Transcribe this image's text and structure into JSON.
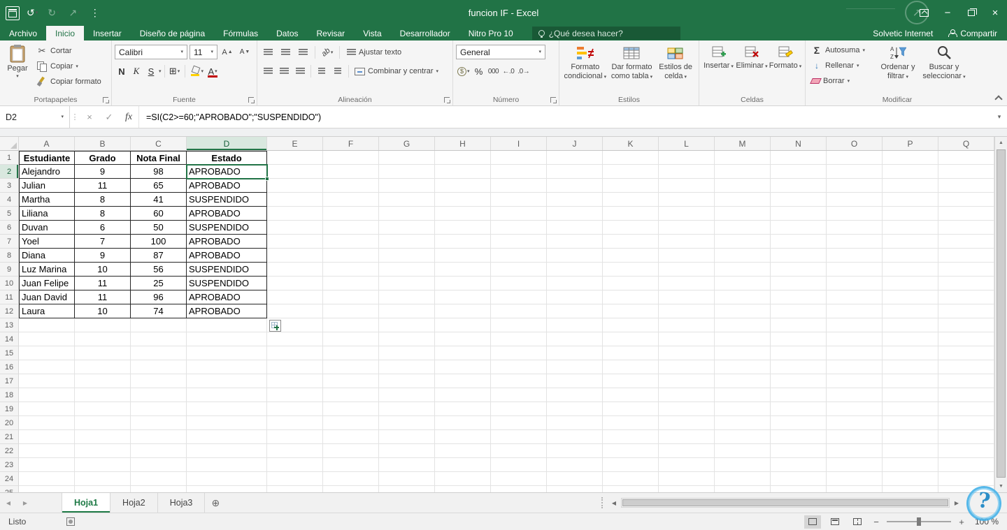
{
  "title_bar": {
    "title": "funcion IF - Excel",
    "account_name": "Solvetic Internet",
    "share_label": "Compartir"
  },
  "search": {
    "placeholder": "¿Qué desea hacer?"
  },
  "ribbon_tabs": [
    {
      "label": "Archivo",
      "active": false
    },
    {
      "label": "Inicio",
      "active": true
    },
    {
      "label": "Insertar",
      "active": false
    },
    {
      "label": "Diseño de página",
      "active": false
    },
    {
      "label": "Fórmulas",
      "active": false
    },
    {
      "label": "Datos",
      "active": false
    },
    {
      "label": "Revisar",
      "active": false
    },
    {
      "label": "Vista",
      "active": false
    },
    {
      "label": "Desarrollador",
      "active": false
    },
    {
      "label": "Nitro Pro 10",
      "active": false
    }
  ],
  "ribbon": {
    "clipboard": {
      "paste": "Pegar",
      "cut": "Cortar",
      "copy": "Copiar",
      "format_painter": "Copiar formato",
      "group_label": "Portapapeles"
    },
    "font": {
      "family": "Calibri",
      "size": "11",
      "bold": "N",
      "italic": "K",
      "underline": "S",
      "group_label": "Fuente"
    },
    "alignment": {
      "wrap_text": "Ajustar texto",
      "merge_center": "Combinar y centrar",
      "group_label": "Alineación"
    },
    "number": {
      "format": "General",
      "percent": "%",
      "thousands": "000",
      "group_label": "Número"
    },
    "styles": {
      "conditional": "Formato condicional",
      "format_table": "Dar formato como tabla",
      "cell_styles": "Estilos de celda",
      "group_label": "Estilos"
    },
    "cells": {
      "insert": "Insertar",
      "delete": "Eliminar",
      "format": "Formato",
      "group_label": "Celdas"
    },
    "editing": {
      "autosum": "Autosuma",
      "fill": "Rellenar",
      "clear": "Borrar",
      "sort": "Ordenar y filtrar",
      "find": "Buscar y seleccionar",
      "group_label": "Modificar"
    }
  },
  "formula_bar": {
    "name_box": "D2",
    "formula": "=SI(C2>=60;\"APROBADO\";\"SUSPENDIDO\")"
  },
  "grid": {
    "columns": [
      "A",
      "B",
      "C",
      "D",
      "E",
      "F",
      "G",
      "H",
      "I",
      "J",
      "K",
      "L",
      "M",
      "N",
      "O",
      "P",
      "Q"
    ],
    "row_count": 25,
    "selected": {
      "column": "D",
      "row": 2
    },
    "table": {
      "headers": [
        "Estudiante",
        "Grado",
        "Nota Final",
        "Estado"
      ],
      "rows": [
        [
          "Alejandro",
          "9",
          "98",
          "APROBADO"
        ],
        [
          "Julian",
          "11",
          "65",
          "APROBADO"
        ],
        [
          "Martha",
          "8",
          "41",
          "SUSPENDIDO"
        ],
        [
          "Liliana",
          "8",
          "60",
          "APROBADO"
        ],
        [
          "Duvan",
          "6",
          "50",
          "SUSPENDIDO"
        ],
        [
          "Yoel",
          "7",
          "100",
          "APROBADO"
        ],
        [
          "Diana",
          "9",
          "87",
          "APROBADO"
        ],
        [
          "Luz Marina",
          "10",
          "56",
          "SUSPENDIDO"
        ],
        [
          "Juan Felipe",
          "11",
          "25",
          "SUSPENDIDO"
        ],
        [
          "Juan David",
          "11",
          "96",
          "APROBADO"
        ],
        [
          "Laura",
          "10",
          "74",
          "APROBADO"
        ]
      ]
    }
  },
  "sheet_tabs": {
    "tabs": [
      {
        "label": "Hoja1",
        "active": true
      },
      {
        "label": "Hoja2",
        "active": false
      },
      {
        "label": "Hoja3",
        "active": false
      }
    ]
  },
  "status_bar": {
    "ready_label": "Listo",
    "zoom_level": "100 %"
  },
  "icons": {
    "chevron_down": "▾",
    "undo": "↺",
    "redo": "↻",
    "scissors": "✂",
    "cancel": "×",
    "check": "✓",
    "fx": "fx",
    "close": "×",
    "minimize": "−",
    "sigma": "Σ",
    "add_sheet": "⊕",
    "tri_left": "◀",
    "tri_right": "▶",
    "tri_up": "▲",
    "tri_down": "▼",
    "borders_grid": "⊞",
    "increase_decimal": "←.0",
    "decrease_decimal": ".0→",
    "dots": "⋮",
    "question": "?",
    "fill_down": "↓",
    "letter_a": "A",
    "currency": "$",
    "orientation": "ab",
    "plus": "+",
    "minus": "−",
    "arrow_ne": "↗"
  }
}
